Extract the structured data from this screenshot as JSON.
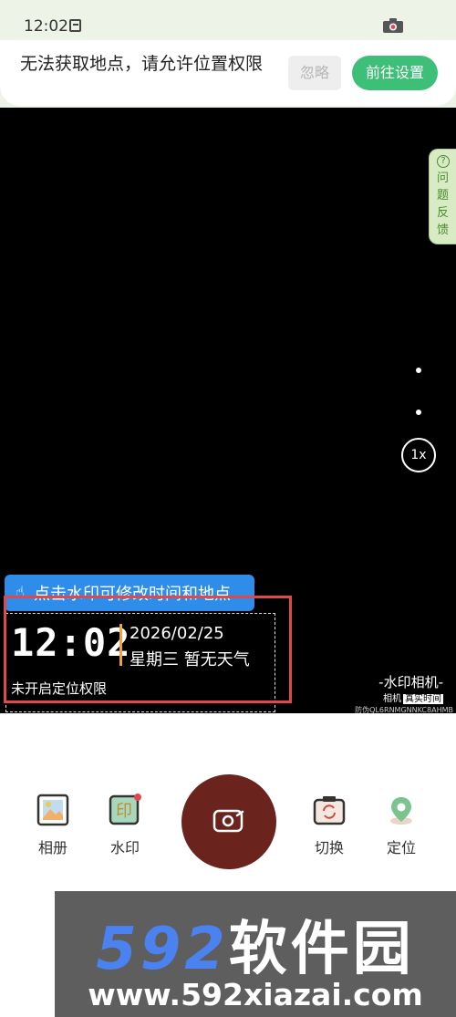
{
  "status_bar": {
    "time": "12:02",
    "app_icon": "notification-box-icon",
    "camera_icon": "camera-icon"
  },
  "banner": {
    "message": "无法获取地点，请允许位置权限",
    "ignore_label": "忽略",
    "settings_label": "前往设置"
  },
  "viewfinder": {
    "feedback_icon": "question-circle-icon",
    "feedback_label": "问题反馈",
    "zoom_label": "1x",
    "tip_text": "点击水印可修改时间和地点"
  },
  "watermark": {
    "time": "12:02",
    "date": "2026/02/25",
    "weekday_weather": "星期三  暂无天气",
    "location": "未开启定位权限"
  },
  "brand": {
    "title": "-水印相机-",
    "sub_a": "相机",
    "sub_b": "真实时间",
    "code": "防伪QL6RNMGNNKC8AHMB"
  },
  "controls": {
    "album_label": "相册",
    "watermark_label": "水印",
    "switch_label": "切换",
    "locate_label": "定位"
  },
  "footer": {
    "logo_num": "592",
    "logo_txt": "软件园",
    "url": "www.592xiazai.com"
  },
  "colors": {
    "accent_green": "#3dbf78",
    "shutter": "#6b231e",
    "highlight_red": "#e0484b",
    "tip_blue": "#2d8de8"
  }
}
